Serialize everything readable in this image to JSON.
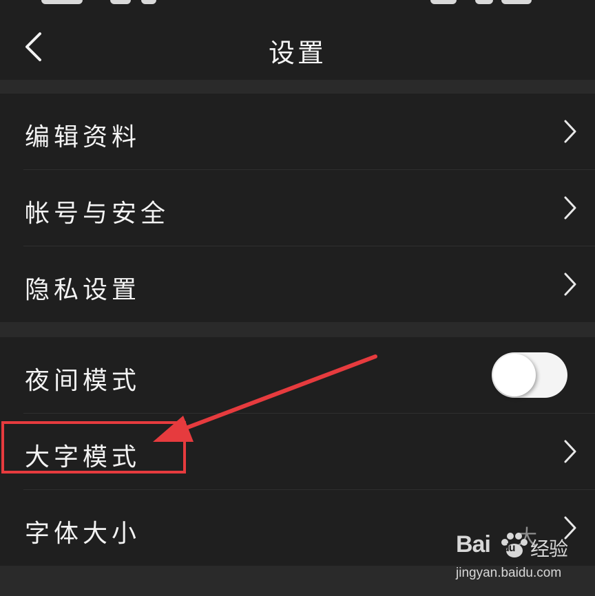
{
  "header": {
    "title": "设置",
    "back_icon": "chevron-left-icon"
  },
  "group1": [
    {
      "label": "编辑资料",
      "icon": "chevron-right-icon"
    },
    {
      "label": "帐号与安全",
      "icon": "chevron-right-icon"
    },
    {
      "label": "隐私设置",
      "icon": "chevron-right-icon"
    }
  ],
  "group2": {
    "night_mode": {
      "label": "夜间模式",
      "toggle_on": false
    },
    "large_text": {
      "label": "大字模式",
      "icon": "chevron-right-icon"
    },
    "font_size": {
      "label": "字体大小",
      "value": "大",
      "icon": "chevron-right-icon"
    }
  },
  "annotation": {
    "color": "#e63b3e"
  },
  "watermark": {
    "brand_left": "Bai",
    "brand_mid": "du",
    "brand_right": "经验",
    "url": "jingyan.baidu.com"
  },
  "colors": {
    "background": "#1f1f1f",
    "separator": "#2a2a2a",
    "text": "#f3f3f3",
    "secondary": "#8f8f8f"
  }
}
